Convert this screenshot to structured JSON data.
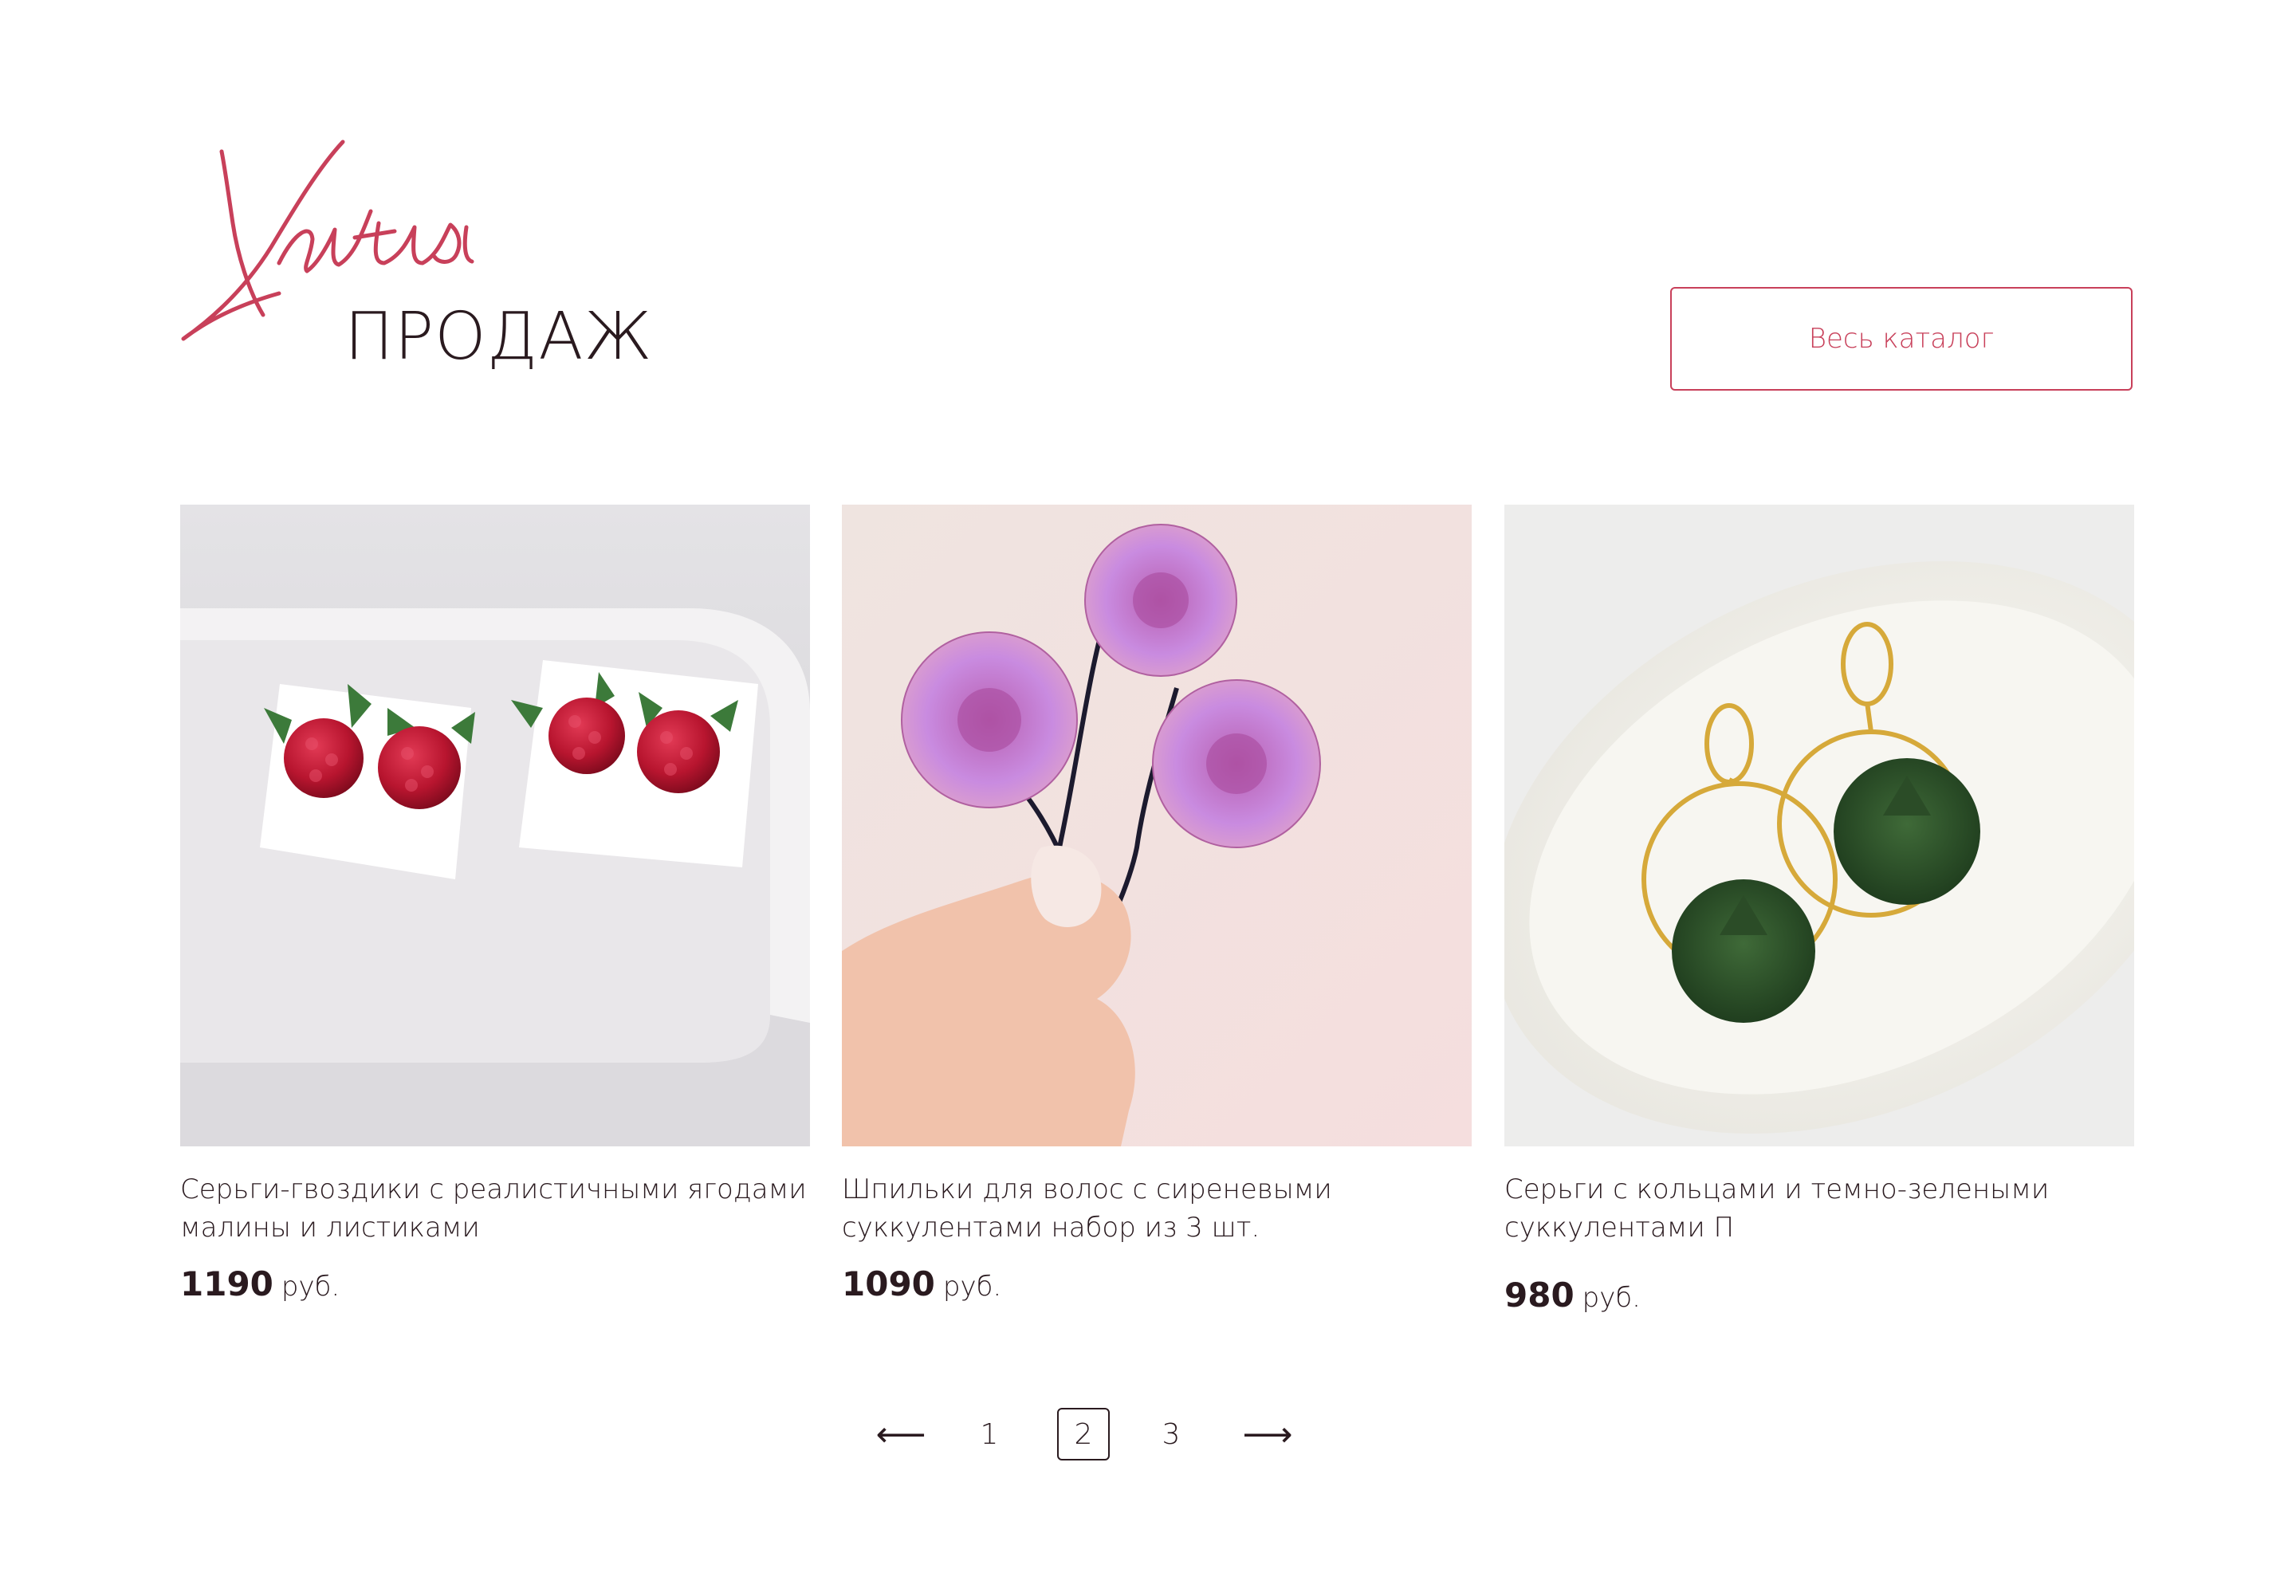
{
  "header": {
    "script_title": "Хиты",
    "subtitle": "ПРОДАЖ",
    "catalog_button": "Весь каталог"
  },
  "colors": {
    "accent": "#c8405a",
    "text": "#2a1a1f",
    "background": "#ffffff"
  },
  "products": [
    {
      "title": "Серьги-гвоздики  с реалистичными ягодами малины и листиками",
      "price": "1190",
      "currency": "руб.",
      "image": "raspberry-stud-earrings"
    },
    {
      "title": "Шпильки для волос с сиреневыми суккулентами набор из  3 шт.",
      "price": "1090",
      "currency": "руб.",
      "image": "lilac-succulent-hairpins"
    },
    {
      "title": "Серьги с кольцами и темно-зелеными суккулентами П",
      "price": "980",
      "currency": "руб.",
      "image": "green-succulent-hoop-earrings"
    }
  ],
  "pagination": {
    "prev": "⟵",
    "pages": [
      "1",
      "2",
      "3"
    ],
    "current": "2",
    "next": "⟶"
  }
}
